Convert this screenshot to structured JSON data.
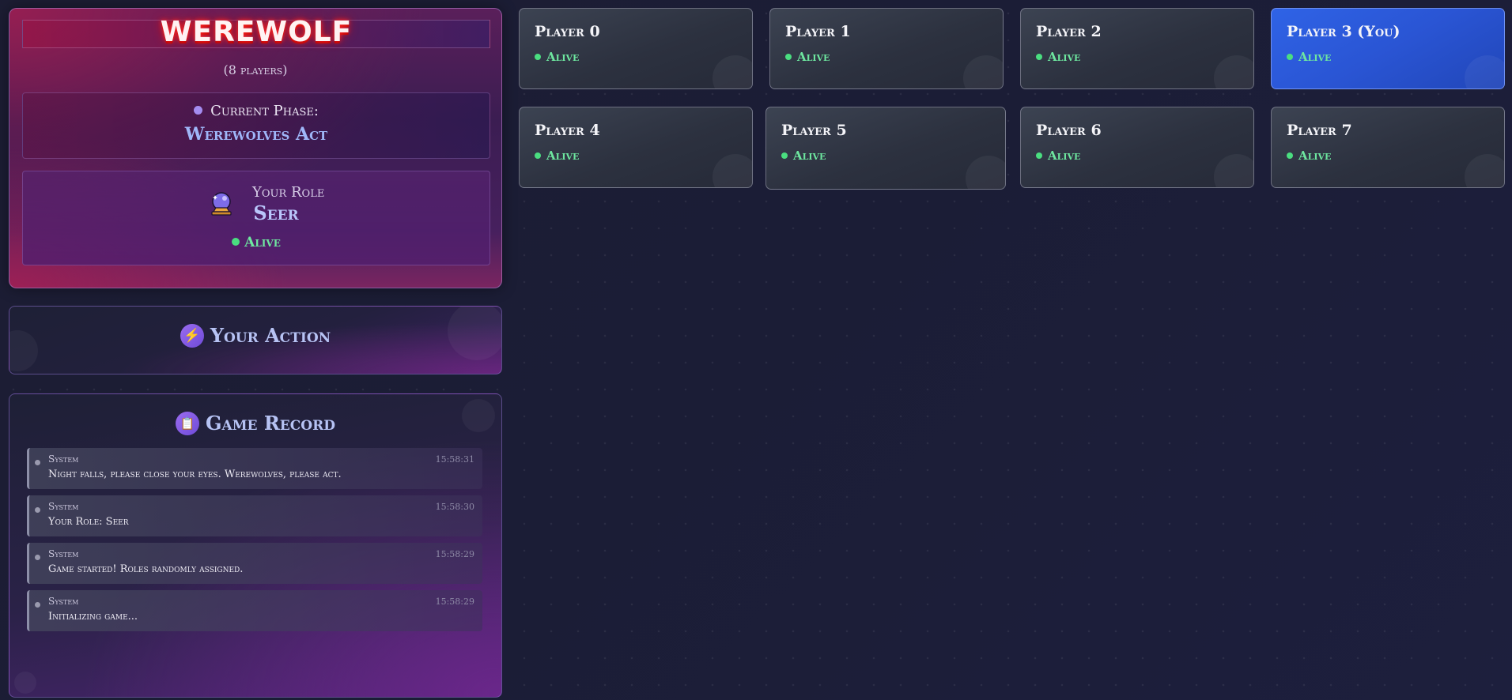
{
  "game": {
    "title": "WEREWOLF",
    "players_count": "(8 players)",
    "phase_label": "Current Phase:",
    "phase_value": "Werewolves Act",
    "role_label": "Your Role",
    "role_value": "Seer",
    "role_icon": "crystal-ball-icon",
    "self_status": "Alive"
  },
  "action": {
    "title": "Your Action",
    "icon": "lightning-icon"
  },
  "record": {
    "title": "Game Record",
    "icon": "clipboard-icon",
    "entries": [
      {
        "source": "System",
        "time": "15:58:31",
        "message": "Night falls, please close your eyes. Werewolves, please act."
      },
      {
        "source": "System",
        "time": "15:58:30",
        "message": "Your Role: Seer"
      },
      {
        "source": "System",
        "time": "15:58:29",
        "message": "Game started! Roles randomly assigned."
      },
      {
        "source": "System",
        "time": "15:58:29",
        "message": "Initializing game..."
      }
    ]
  },
  "players": [
    {
      "name": "Player 0",
      "status": "Alive"
    },
    {
      "name": "Player 1",
      "status": "Alive"
    },
    {
      "name": "Player 2",
      "status": "Alive"
    },
    {
      "name": "Player 3 (You)",
      "status": "Alive"
    },
    {
      "name": "Player 4",
      "status": "Alive"
    },
    {
      "name": "Player 5",
      "status": "Alive"
    },
    {
      "name": "Player 6",
      "status": "Alive"
    },
    {
      "name": "Player 7",
      "status": "Alive"
    }
  ],
  "colors": {
    "alive": "#4ade80",
    "self_card": "#2f63e6",
    "title_glow": "#ff2a2a",
    "accent": "#9fb6f8"
  }
}
